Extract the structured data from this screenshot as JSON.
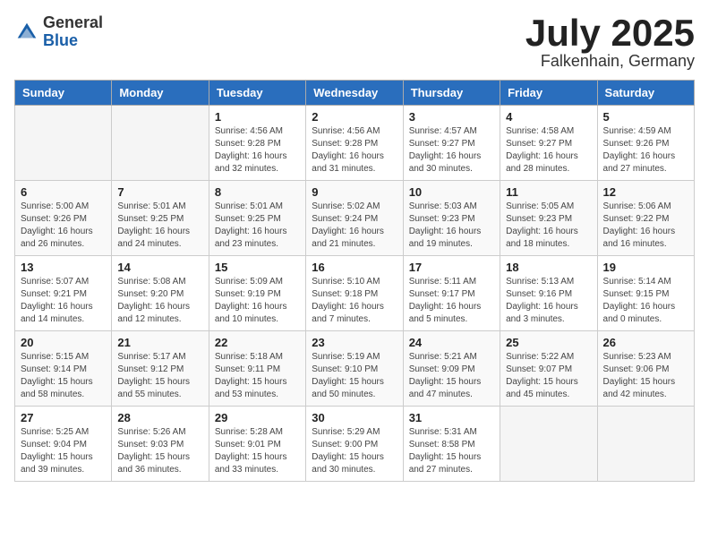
{
  "header": {
    "logo_general": "General",
    "logo_blue": "Blue",
    "month": "July 2025",
    "location": "Falkenhain, Germany"
  },
  "weekdays": [
    "Sunday",
    "Monday",
    "Tuesday",
    "Wednesday",
    "Thursday",
    "Friday",
    "Saturday"
  ],
  "weeks": [
    [
      {
        "day": "",
        "info": ""
      },
      {
        "day": "",
        "info": ""
      },
      {
        "day": "1",
        "info": "Sunrise: 4:56 AM\nSunset: 9:28 PM\nDaylight: 16 hours\nand 32 minutes."
      },
      {
        "day": "2",
        "info": "Sunrise: 4:56 AM\nSunset: 9:28 PM\nDaylight: 16 hours\nand 31 minutes."
      },
      {
        "day": "3",
        "info": "Sunrise: 4:57 AM\nSunset: 9:27 PM\nDaylight: 16 hours\nand 30 minutes."
      },
      {
        "day": "4",
        "info": "Sunrise: 4:58 AM\nSunset: 9:27 PM\nDaylight: 16 hours\nand 28 minutes."
      },
      {
        "day": "5",
        "info": "Sunrise: 4:59 AM\nSunset: 9:26 PM\nDaylight: 16 hours\nand 27 minutes."
      }
    ],
    [
      {
        "day": "6",
        "info": "Sunrise: 5:00 AM\nSunset: 9:26 PM\nDaylight: 16 hours\nand 26 minutes."
      },
      {
        "day": "7",
        "info": "Sunrise: 5:01 AM\nSunset: 9:25 PM\nDaylight: 16 hours\nand 24 minutes."
      },
      {
        "day": "8",
        "info": "Sunrise: 5:01 AM\nSunset: 9:25 PM\nDaylight: 16 hours\nand 23 minutes."
      },
      {
        "day": "9",
        "info": "Sunrise: 5:02 AM\nSunset: 9:24 PM\nDaylight: 16 hours\nand 21 minutes."
      },
      {
        "day": "10",
        "info": "Sunrise: 5:03 AM\nSunset: 9:23 PM\nDaylight: 16 hours\nand 19 minutes."
      },
      {
        "day": "11",
        "info": "Sunrise: 5:05 AM\nSunset: 9:23 PM\nDaylight: 16 hours\nand 18 minutes."
      },
      {
        "day": "12",
        "info": "Sunrise: 5:06 AM\nSunset: 9:22 PM\nDaylight: 16 hours\nand 16 minutes."
      }
    ],
    [
      {
        "day": "13",
        "info": "Sunrise: 5:07 AM\nSunset: 9:21 PM\nDaylight: 16 hours\nand 14 minutes."
      },
      {
        "day": "14",
        "info": "Sunrise: 5:08 AM\nSunset: 9:20 PM\nDaylight: 16 hours\nand 12 minutes."
      },
      {
        "day": "15",
        "info": "Sunrise: 5:09 AM\nSunset: 9:19 PM\nDaylight: 16 hours\nand 10 minutes."
      },
      {
        "day": "16",
        "info": "Sunrise: 5:10 AM\nSunset: 9:18 PM\nDaylight: 16 hours\nand 7 minutes."
      },
      {
        "day": "17",
        "info": "Sunrise: 5:11 AM\nSunset: 9:17 PM\nDaylight: 16 hours\nand 5 minutes."
      },
      {
        "day": "18",
        "info": "Sunrise: 5:13 AM\nSunset: 9:16 PM\nDaylight: 16 hours\nand 3 minutes."
      },
      {
        "day": "19",
        "info": "Sunrise: 5:14 AM\nSunset: 9:15 PM\nDaylight: 16 hours\nand 0 minutes."
      }
    ],
    [
      {
        "day": "20",
        "info": "Sunrise: 5:15 AM\nSunset: 9:14 PM\nDaylight: 15 hours\nand 58 minutes."
      },
      {
        "day": "21",
        "info": "Sunrise: 5:17 AM\nSunset: 9:12 PM\nDaylight: 15 hours\nand 55 minutes."
      },
      {
        "day": "22",
        "info": "Sunrise: 5:18 AM\nSunset: 9:11 PM\nDaylight: 15 hours\nand 53 minutes."
      },
      {
        "day": "23",
        "info": "Sunrise: 5:19 AM\nSunset: 9:10 PM\nDaylight: 15 hours\nand 50 minutes."
      },
      {
        "day": "24",
        "info": "Sunrise: 5:21 AM\nSunset: 9:09 PM\nDaylight: 15 hours\nand 47 minutes."
      },
      {
        "day": "25",
        "info": "Sunrise: 5:22 AM\nSunset: 9:07 PM\nDaylight: 15 hours\nand 45 minutes."
      },
      {
        "day": "26",
        "info": "Sunrise: 5:23 AM\nSunset: 9:06 PM\nDaylight: 15 hours\nand 42 minutes."
      }
    ],
    [
      {
        "day": "27",
        "info": "Sunrise: 5:25 AM\nSunset: 9:04 PM\nDaylight: 15 hours\nand 39 minutes."
      },
      {
        "day": "28",
        "info": "Sunrise: 5:26 AM\nSunset: 9:03 PM\nDaylight: 15 hours\nand 36 minutes."
      },
      {
        "day": "29",
        "info": "Sunrise: 5:28 AM\nSunset: 9:01 PM\nDaylight: 15 hours\nand 33 minutes."
      },
      {
        "day": "30",
        "info": "Sunrise: 5:29 AM\nSunset: 9:00 PM\nDaylight: 15 hours\nand 30 minutes."
      },
      {
        "day": "31",
        "info": "Sunrise: 5:31 AM\nSunset: 8:58 PM\nDaylight: 15 hours\nand 27 minutes."
      },
      {
        "day": "",
        "info": ""
      },
      {
        "day": "",
        "info": ""
      }
    ]
  ]
}
